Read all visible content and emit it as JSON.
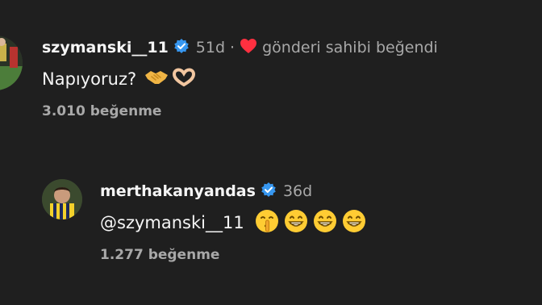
{
  "comments": [
    {
      "username": "szymanski__11",
      "time": "51d",
      "separator": "·",
      "liked_by": "gönderi sahibi beğendi",
      "text": "Napıyoruz?",
      "emojis": [
        "handshake-emoji",
        "heart-hands-emoji"
      ],
      "likes": "3.010 beğenme"
    },
    {
      "username": "merthakanyandas",
      "time": "36d",
      "text": "@szymanski__11",
      "emojis": [
        "shushing-face-emoji",
        "grinning-face-emoji",
        "grinning-face-emoji",
        "grinning-face-emoji"
      ],
      "likes": "1.277 beğenme"
    }
  ],
  "colors": {
    "background": "#1f1f1f",
    "verified": "#3797f0",
    "heart": "#ff3040",
    "muted": "#a8a8a8"
  }
}
